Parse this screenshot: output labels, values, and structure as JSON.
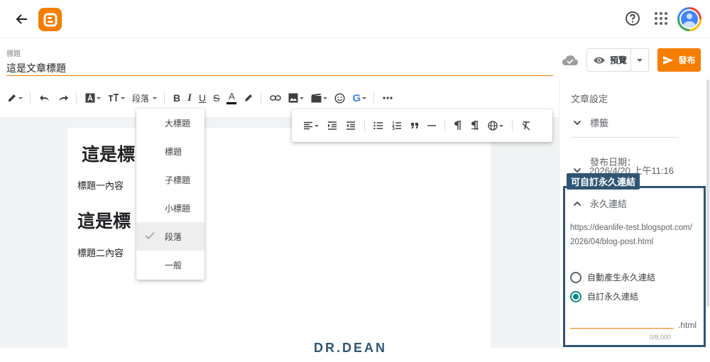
{
  "header": {
    "back_icon": "arrow-back-icon",
    "logo_icon": "blogger-logo-icon",
    "help_icon": "help-circle-icon",
    "apps_icon": "apps-grid-icon",
    "avatar_icon": "account-avatar-icon"
  },
  "post": {
    "title_label": "標題",
    "title_value": "這是文章標題"
  },
  "actions": {
    "preview_label": "預覽",
    "publish_label": "發布",
    "cloud_icon": "cloud-saved-icon"
  },
  "toolbar": {
    "paragraph_label": "段落",
    "bold": "B",
    "italic": "I",
    "underline": "U",
    "strike": "S",
    "text_color": "A",
    "google_label": "G"
  },
  "paragraph_menu": {
    "items": [
      {
        "label": "大標題",
        "selected": false
      },
      {
        "label": "標題",
        "selected": false
      },
      {
        "label": "子標題",
        "selected": false
      },
      {
        "label": "小標題",
        "selected": false
      },
      {
        "label": "段落",
        "selected": true
      },
      {
        "label": "一般",
        "selected": false
      }
    ]
  },
  "editor": {
    "heading1": "這是標",
    "para1": "標題一內容",
    "heading2": "這是標",
    "para2": "標題二內容"
  },
  "side": {
    "title": "文章設定",
    "labels_section": "標籤",
    "date_label": "發布日期：",
    "date_value": "2026/4/20 上午11:16",
    "highlight_tag": "可自訂永久連結",
    "permalink_section": "永久連結",
    "permalink_url": "https://deanlife-test.blogspot.com/2026/04/blog-post.html",
    "option_auto": "自動產生永久連結",
    "option_custom": "自訂永久連結",
    "custom_value": "",
    "html_suffix": ".html",
    "counter": "0/8,000"
  },
  "watermark": "DR.DEAN",
  "colors": {
    "accent": "#f57d00",
    "highlight": "#2f5573",
    "radio": "#0b8a83"
  }
}
